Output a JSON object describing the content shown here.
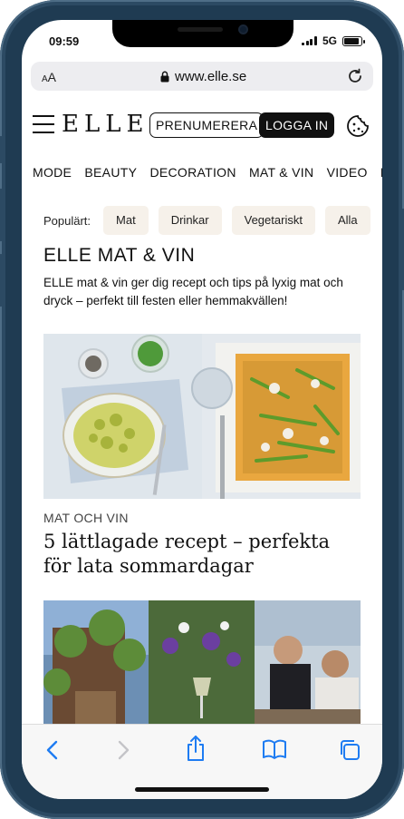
{
  "status": {
    "time": "09:59",
    "network": "5G",
    "battery_fraction": 0.9
  },
  "browser": {
    "text_size_label": "AA",
    "url": "www.elle.se"
  },
  "header": {
    "logo": "ELLE",
    "subscribe_label": "PRENUMERERA",
    "login_label": "LOGGA IN"
  },
  "nav": {
    "items": [
      "MODE",
      "BEAUTY",
      "DECORATION",
      "MAT & VIN",
      "VIDEO",
      "B"
    ]
  },
  "popular": {
    "label": "Populärt:",
    "chips": [
      "Mat",
      "Drinkar",
      "Vegetariskt",
      "Alla"
    ]
  },
  "section": {
    "title": "ELLE MAT & VIN",
    "description": "ELLE mat & vin ger dig recept och tips på lyxig mat och dryck – perfekt till festen eller hemmakvällen!"
  },
  "article": {
    "category": "MAT OCH VIN",
    "headline": "5 lättlagade recept – perfekta för lata sommardagar"
  },
  "icons": {
    "back": "chevron-left-icon",
    "forward": "chevron-right-icon",
    "share": "share-icon",
    "bookmarks": "book-icon",
    "tabs": "tabs-icon",
    "cookie": "cookie-icon",
    "lock": "lock-icon",
    "reload": "reload-icon"
  },
  "colors": {
    "frame": "#1f3b52",
    "chip_bg": "#f6f1ea",
    "accent_ios": "#1e7cf2"
  }
}
